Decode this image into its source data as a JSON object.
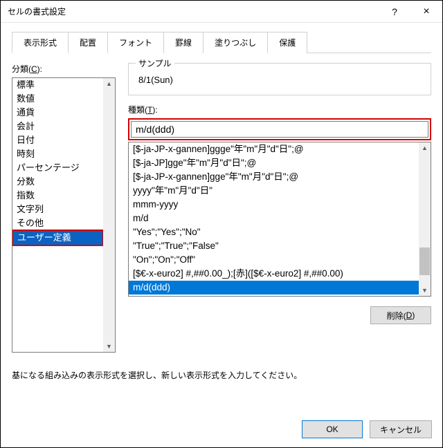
{
  "window": {
    "title": "セルの書式設定",
    "help": "?",
    "close": "×"
  },
  "tabs": [
    "表示形式",
    "配置",
    "フォント",
    "罫線",
    "塗りつぶし",
    "保護"
  ],
  "activeTab": 0,
  "category": {
    "label_pre": "分類(",
    "label_u": "C",
    "label_post": "):",
    "items": [
      "標準",
      "数値",
      "通貨",
      "会計",
      "日付",
      "時刻",
      "パーセンテージ",
      "分数",
      "指数",
      "文字列",
      "その他",
      "ユーザー定義"
    ],
    "selectedIndex": 11
  },
  "sample": {
    "label": "サンプル",
    "value": "8/1(Sun)"
  },
  "type": {
    "label_pre": "種類(",
    "label_u": "T",
    "label_post": "):",
    "value": "m/d(ddd)",
    "items": [
      "[$-ja-JP-x-gannen]ggge\"年\"m\"月\"d\"日\";@",
      "[$-ja-JP]gge\"年\"m\"月\"d\"日\";@",
      "[$-ja-JP-x-gannen]gge\"年\"m\"月\"d\"日\";@",
      "yyyy\"年\"m\"月\"d\"日\"",
      "mmm-yyyy",
      "m/d",
      "\"Yes\";\"Yes\";\"No\"",
      "\"True\";\"True\";\"False\"",
      "\"On\";\"On\";\"Off\"",
      "[$€-x-euro2] #,##0.00_);[赤]([$€-x-euro2] #,##0.00)",
      "m/d(ddd)"
    ],
    "selectedIndex": 10
  },
  "deleteBtn": {
    "pre": "削除(",
    "u": "D",
    "post": ")"
  },
  "hint": "基になる組み込みの表示形式を選択し、新しい表示形式を入力してください。",
  "footer": {
    "ok": "OK",
    "cancel": "キャンセル"
  }
}
